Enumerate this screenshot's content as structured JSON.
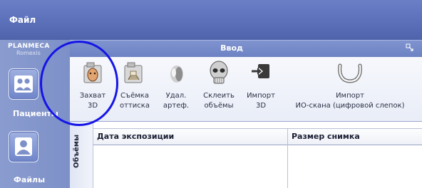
{
  "menu": {
    "file": "Файл"
  },
  "logo": {
    "brand": "PLANMECA",
    "product": "Romexis"
  },
  "nav": {
    "patients": {
      "label": "Пациенты",
      "icon": "patients-icon"
    },
    "files": {
      "label": "Файлы",
      "icon": "files-icon"
    }
  },
  "ribbon": {
    "title": "Ввод",
    "launcher_icon": "dialog-launcher-icon",
    "tools": [
      {
        "line1": "Захват",
        "line2": "3D",
        "icon": "capture-3d-icon"
      },
      {
        "line1": "Съёмка",
        "line2": "оттиска",
        "icon": "impression-scan-icon"
      },
      {
        "line1": "Удал.",
        "line2": "артеф.",
        "icon": "remove-artifacts-icon"
      },
      {
        "line1": "Склеить",
        "line2": "объёмы",
        "icon": "stitch-volumes-icon"
      },
      {
        "line1": "Импорт",
        "line2": "3D",
        "icon": "import-3d-icon"
      },
      {
        "line1": "Импорт",
        "line2": "ИО-скана (цифровой слепок)",
        "icon": "import-io-scan-icon"
      }
    ]
  },
  "table": {
    "side_tab": "Объёмы",
    "columns": [
      "Дата экспозиции",
      "Размер снимка"
    ]
  },
  "colors": {
    "menubar": "#5b70b9",
    "ribbon_header": "#7388c8",
    "annotation": "#1515e6"
  }
}
